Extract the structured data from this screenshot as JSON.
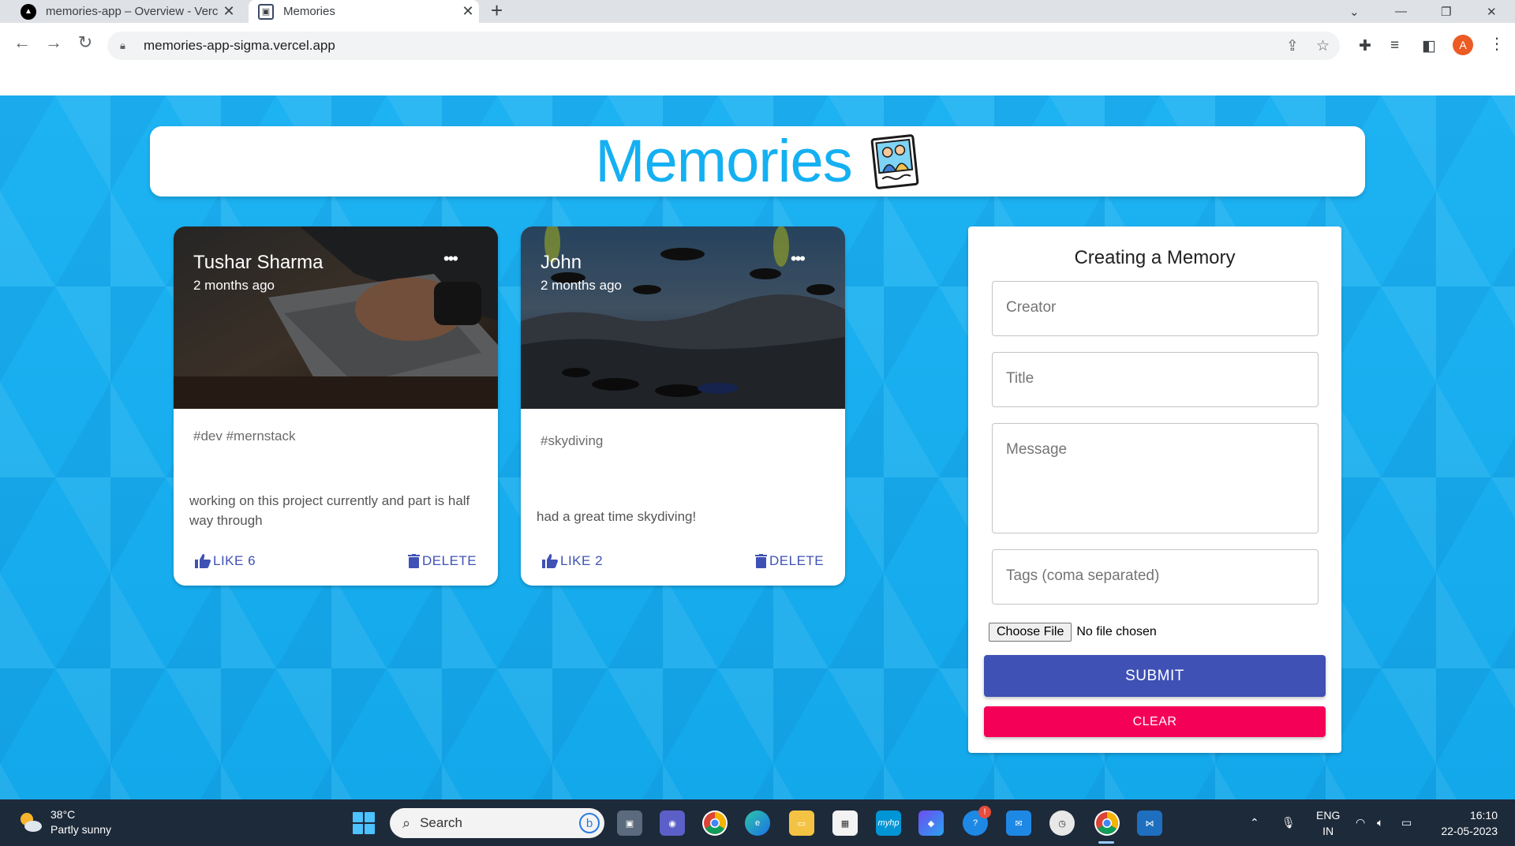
{
  "browser": {
    "tabs": [
      {
        "title": "memories-app – Overview - Verc",
        "favicon": "vercel-icon",
        "active": false
      },
      {
        "title": "Memories",
        "favicon": "memories-photo-icon",
        "active": true
      }
    ],
    "new_tab": "+",
    "url": "memories-app-sigma.vercel.app",
    "profile_initial": "A"
  },
  "app": {
    "title": "Memories",
    "logo": "memories-photo-icon",
    "brand_color": "#14b0f2"
  },
  "posts": [
    {
      "author": "Tushar Sharma",
      "time": "2 months ago",
      "tags": "#dev #mernstack",
      "message": "working on this project currently and part is half way through",
      "like_label": "LIKE 6",
      "delete_label": "DELETE",
      "more": "•••",
      "image": "laptop-typing-photo"
    },
    {
      "author": "John",
      "time": "2 months ago",
      "tags": "#skydiving",
      "message": "had a great time skydiving!",
      "like_label": "LIKE 2",
      "delete_label": "DELETE",
      "more": "•••",
      "image": "skydivers-photo"
    }
  ],
  "form": {
    "title": "Creating a Memory",
    "creator_placeholder": "Creator",
    "title_placeholder": "Title",
    "message_placeholder": "Message",
    "tags_placeholder": "Tags (coma separated)",
    "file_button": "Choose File",
    "file_status": "No file chosen",
    "submit_label": "SUBMIT",
    "clear_label": "CLEAR",
    "submit_color": "#3f51b5",
    "clear_color": "#f50057"
  },
  "taskbar": {
    "weather_temp": "38°C",
    "weather_desc": "Partly sunny",
    "search_label": "Search",
    "lang_top": "ENG",
    "lang_bottom": "IN",
    "time": "16:10",
    "date": "22-05-2023",
    "apps": [
      "file-explorer-icon",
      "teams-icon",
      "chrome-icon",
      "edge-icon",
      "folder-icon",
      "store-icon",
      "myhp-icon",
      "copilot-icon",
      "support-icon",
      "mail-icon",
      "clock-app-icon",
      "chrome-active-icon",
      "vscode-icon"
    ],
    "myhp_label": "myhp",
    "notification_badge": "!"
  }
}
